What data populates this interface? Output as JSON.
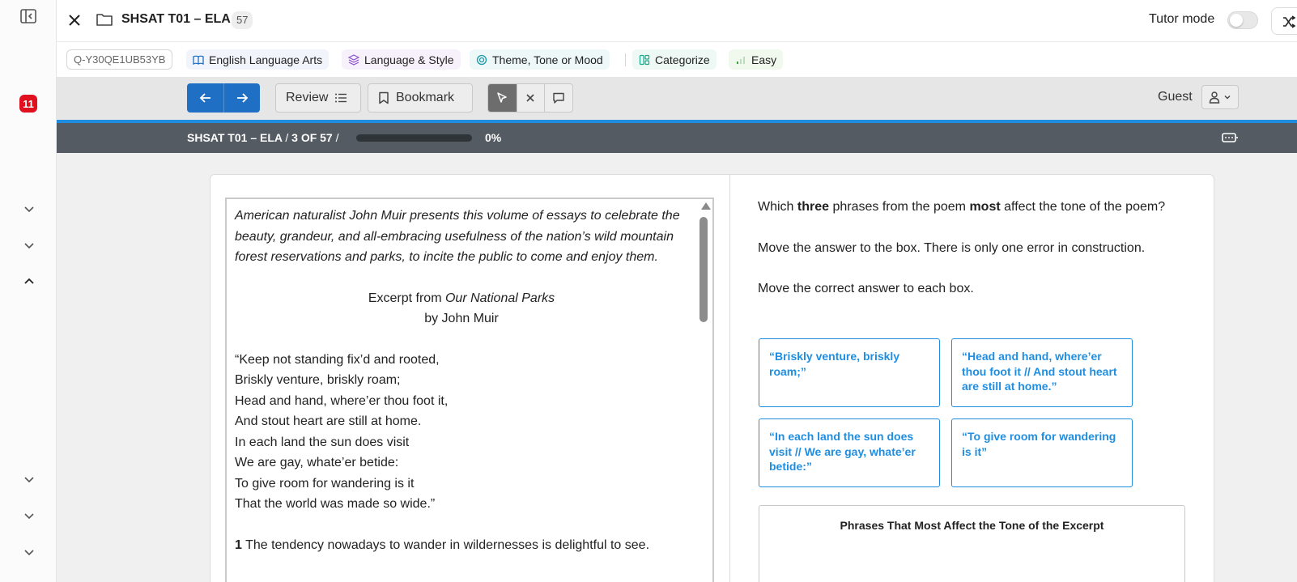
{
  "header": {
    "title": "SHSAT T01 – ELA",
    "count": "57",
    "tutor_mode_label": "Tutor mode"
  },
  "sidebar": {
    "notification_count": "11"
  },
  "tags": {
    "id": "Q-Y30QE1UB53YB",
    "subject": "English Language Arts",
    "topic": "Language & Style",
    "skill": "Theme, Tone or Mood",
    "type": "Categorize",
    "difficulty": "Easy"
  },
  "toolbar": {
    "review_label": "Review",
    "bookmark_label": "Bookmark",
    "guest_label": "Guest"
  },
  "progress": {
    "crumb_title": "SHSAT T01 – ELA",
    "sep1": "/",
    "position": "3 OF 57",
    "sep2": "/",
    "percent_label": "0%",
    "percent_value": 0
  },
  "passage": {
    "intro": "American naturalist John Muir presents this volume of essays to celebrate the beauty, grandeur, and all-embracing usefulness of the nation’s wild mountain forest reservations and parks, to incite the public to come and enjoy them.",
    "excerpt_prefix": "Excerpt from ",
    "excerpt_title": "Our National Parks",
    "byline": "by John Muir",
    "poem": [
      "“Keep not standing fix’d and rooted,",
      "Briskly venture, briskly roam;",
      "Head and hand, where’er thou foot it,",
      "And stout heart are still at home.",
      "In each land the sun does visit",
      "We are gay, whate’er betide:",
      "To give room for wandering is it",
      "That the world was made so wide.”"
    ],
    "para1_number": "1",
    "para1_text": " The tendency nowadays to wander in wildernesses is delightful to see."
  },
  "question": {
    "q_pre": "Which ",
    "q_bold1": "three",
    "q_mid": " phrases from the poem ",
    "q_bold2": "most",
    "q_post": " affect the tone of the poem?",
    "instruction1": "Move the answer to the box. There is only one error in construction.",
    "instruction2": "Move the correct answer to each box."
  },
  "answers": [
    "“Briskly venture, briskly roam;”",
    "“Head and hand, where’er thou foot it // And stout heart are still at home.”",
    "“In each land the sun does visit // We are gay, whate’er betide:”",
    "“To give room for wandering is it”"
  ],
  "dropbox": {
    "title": "Phrases That Most Affect the Tone of the Excerpt"
  },
  "colors": {
    "accent": "#1f6fc4",
    "answer_blue": "#1f8ee0",
    "badge_red": "#e0101e",
    "progress_dark": "#545b62"
  }
}
